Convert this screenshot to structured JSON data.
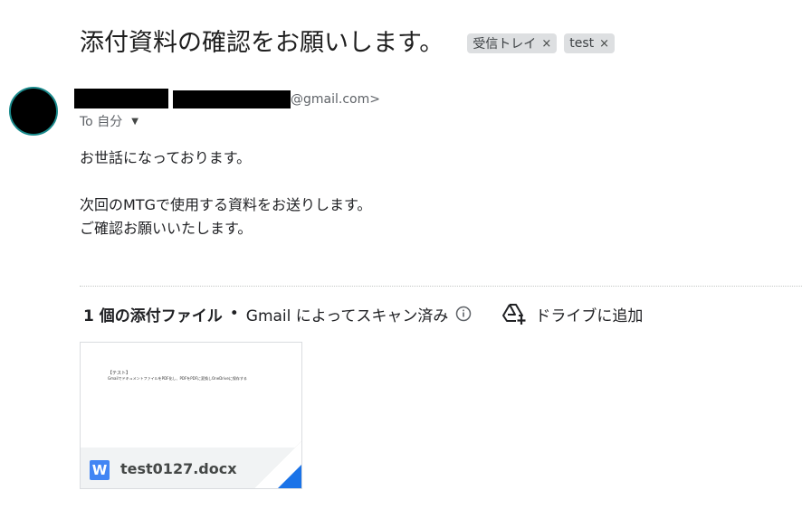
{
  "email": {
    "subject": "添付資料の確認をお願いします。",
    "labels": [
      {
        "name": "受信トレイ",
        "remove": "×"
      },
      {
        "name": "test",
        "remove": "×"
      }
    ],
    "sender_email_domain": "@gmail.com>",
    "to_line": "To 自分",
    "to_caret": "▼",
    "body": {
      "line1": "お世話になっております。",
      "line2": "次回のMTGで使用する資料をお送りします。",
      "line3": "ご確認お願いいたします。"
    }
  },
  "attachments": {
    "count_label": "1 個の添付ファイル",
    "separator": "•",
    "scan_label": "Gmail によってスキャン済み",
    "add_to_drive": "ドライブに追加",
    "items": [
      {
        "file_name": "test0127.docx",
        "file_type_letter": "W",
        "preview_title": "【テスト】",
        "preview_line": "GmailでドキュメントファイルをPDF化し、PDFをPDFに変換しOneDriveに保存する",
        "icon": "word-icon"
      }
    ]
  },
  "colors": {
    "word_blue": "#4285f4",
    "fold_blue": "#1a73e8",
    "chip_bg": "#dddfe1",
    "avatar_ring": "#1a8a8c"
  }
}
